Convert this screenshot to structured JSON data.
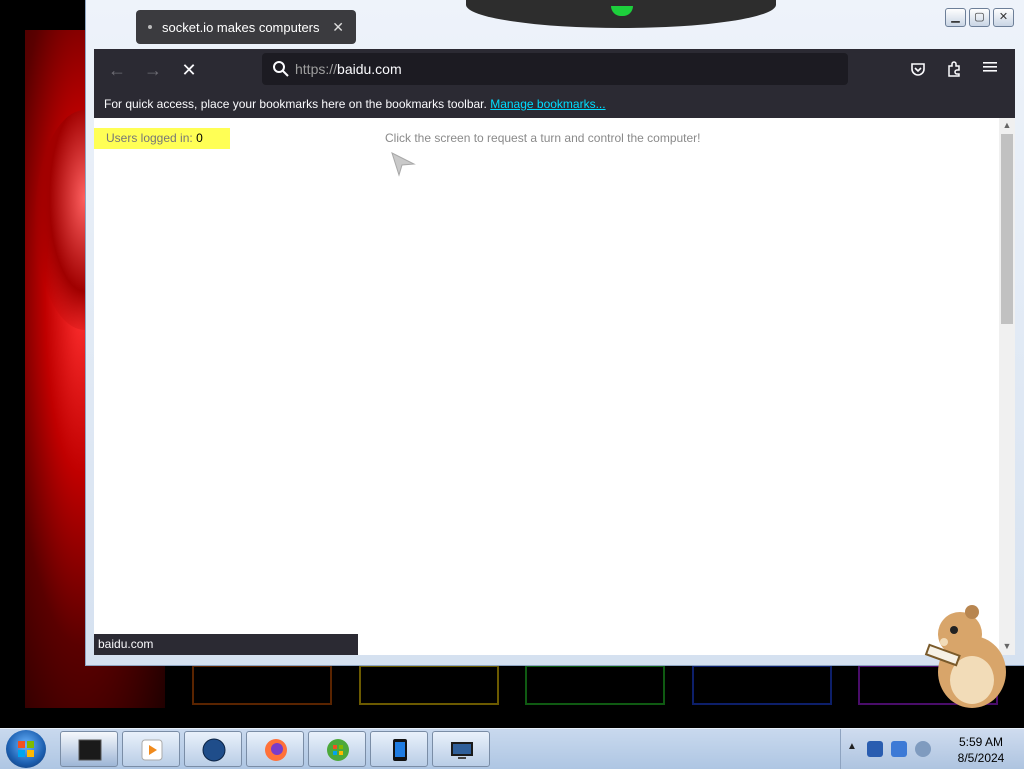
{
  "browser": {
    "tab_title": "socket.io makes computers",
    "url_scheme": "https://",
    "url_host": "baidu.com",
    "bookmarks_message": "For quick access, place your bookmarks here on the bookmarks toolbar.",
    "manage_bookmarks": "Manage bookmarks...",
    "status_url": "baidu.com"
  },
  "page": {
    "users_label": "Users logged in:",
    "users_count": "0",
    "hint": "Click the screen to request a turn and control the computer!"
  },
  "window_controls": {
    "minimize": "▁",
    "maximize": "▢",
    "close": "✕"
  },
  "taskbar": {
    "time": "5:59 AM",
    "date": "8/5/2024"
  }
}
